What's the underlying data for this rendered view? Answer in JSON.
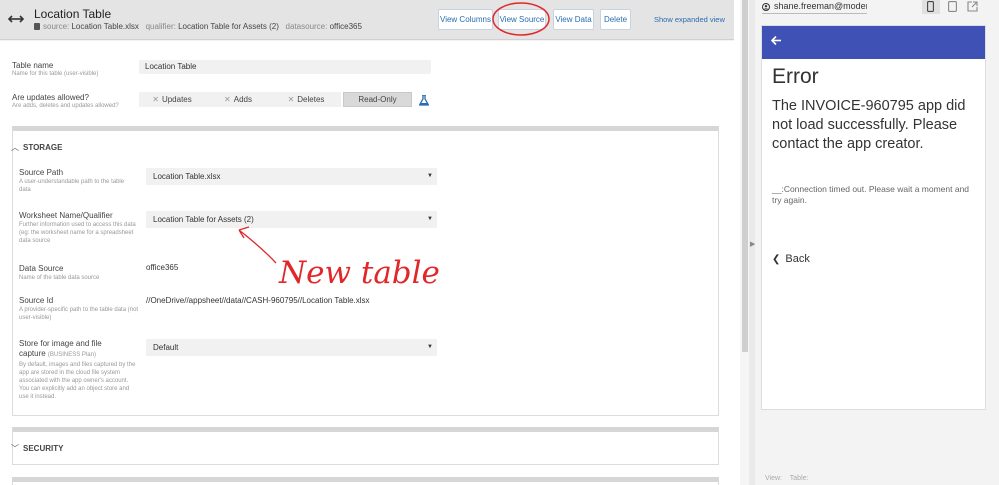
{
  "header": {
    "title": "Location Table",
    "source_label": "source:",
    "source_value": "Location Table.xlsx",
    "qualifier_label": "qualifier:",
    "qualifier_value": "Location Table for Assets (2)",
    "datasource_label": "datasource:",
    "datasource_value": "office365",
    "buttons": {
      "view_columns": "View Columns",
      "view_source": "View Source",
      "view_data": "View Data",
      "delete": "Delete"
    },
    "show_expanded": "Show expanded view"
  },
  "form": {
    "table_name": {
      "label": "Table name",
      "help": "Name for this table (user-visible)",
      "value": "Location Table"
    },
    "updates": {
      "label": "Are updates allowed?",
      "help": "Are adds, deletes and updates allowed?",
      "options": [
        "Updates",
        "Adds",
        "Deletes",
        "Read-Only"
      ],
      "selected": "Read-Only"
    }
  },
  "storage": {
    "title": "STORAGE",
    "source_path": {
      "label": "Source Path",
      "help": "A user-understandable path to the table data",
      "value": "Location Table.xlsx"
    },
    "worksheet": {
      "label": "Worksheet Name/Qualifier",
      "help": "Further information used to access this data (eg: the worksheet name for a spreadsheet data source",
      "value": "Location Table for Assets (2)"
    },
    "data_source": {
      "label": "Data Source",
      "help": "Name of the table data source",
      "value": "office365"
    },
    "source_id": {
      "label": "Source Id",
      "help": "A provider-specific path to the table data (not user-visible)",
      "value": "//OneDrive//appsheet//data//CASH-960795//Location Table.xlsx"
    },
    "store": {
      "label": "Store for image and file capture",
      "plan": "(BUSINESS Plan)",
      "help": "By default, images and files captured by the app are stored in the cloud file system associated with the app owner's account. You can explicitly add an object store and use it instead.",
      "value": "Default"
    }
  },
  "security": {
    "title": "SECURITY"
  },
  "annotation": {
    "text": "New table"
  },
  "preview": {
    "user": "shane.freeman@moderr",
    "error_title": "Error",
    "error_message": "The INVOICE-960795 app did not load successfully. Please contact the app creator.",
    "error_detail": "__:Connection timed out. Please wait a moment and try again.",
    "back_label": "Back",
    "footer_view": "View:",
    "footer_table": "Table:",
    "colors": {
      "appbar": "#3f51b5",
      "accent": "#2b6cb0",
      "annotation": "#e0282b"
    }
  }
}
